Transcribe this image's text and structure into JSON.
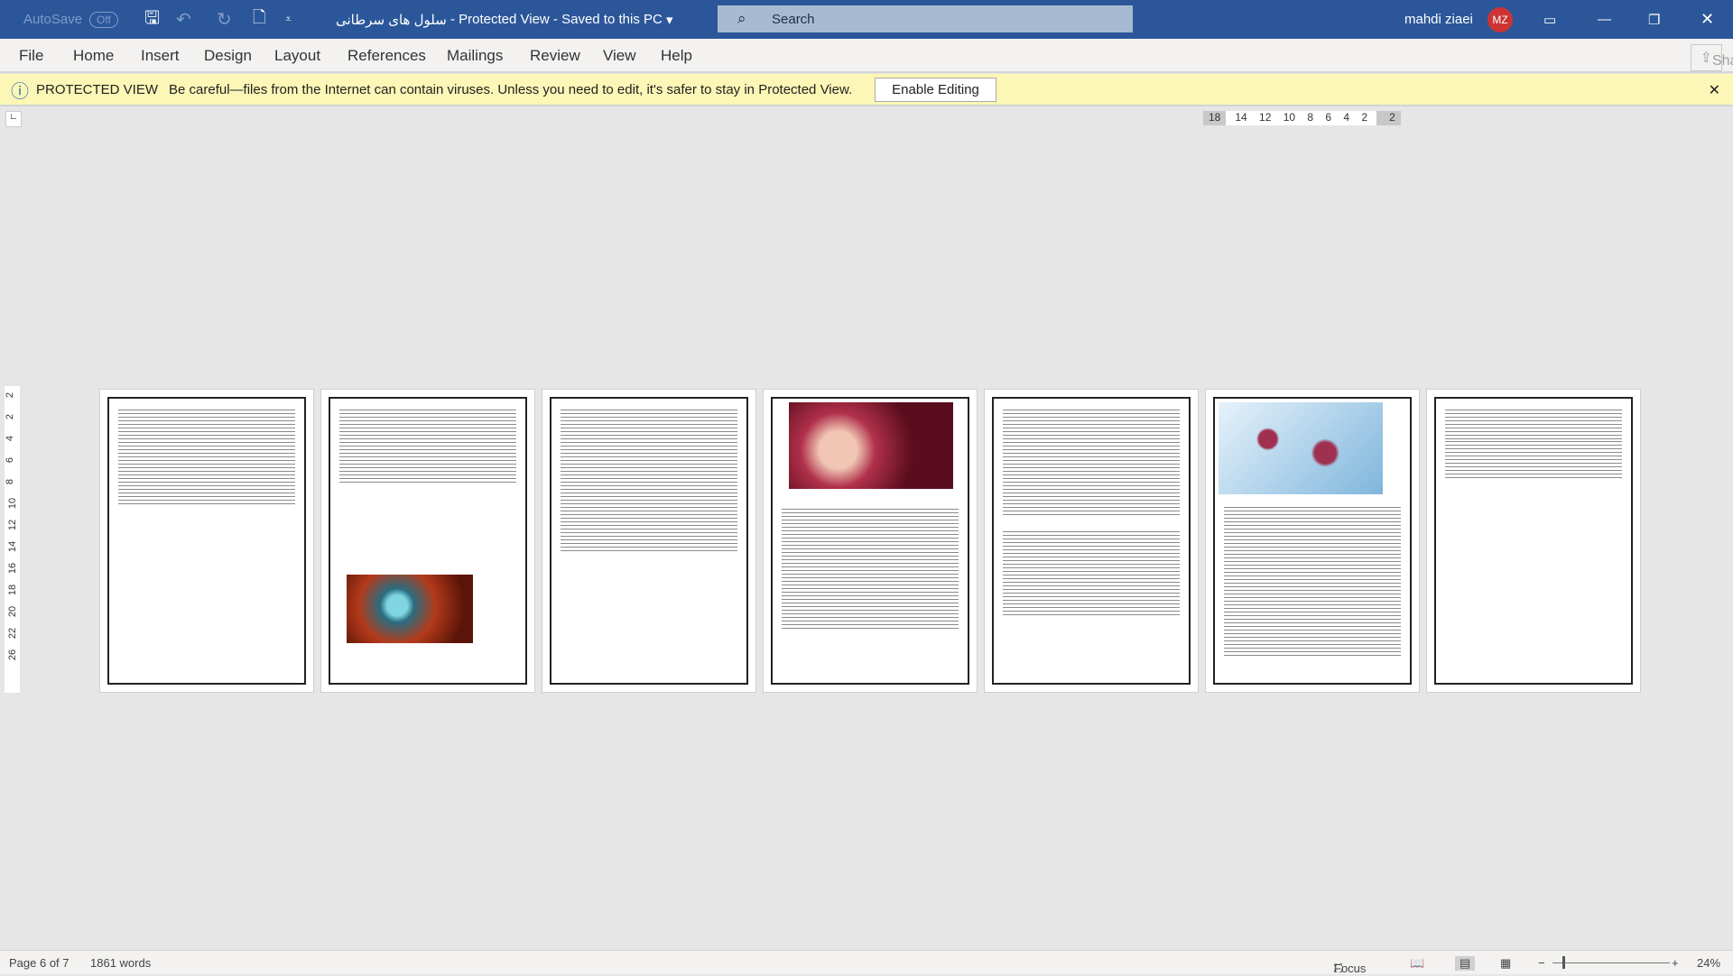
{
  "titlebar": {
    "autosave": "AutoSave",
    "autosave_state": "Off",
    "doc_title": "سلول های سرطانی",
    "mode": "Protected View",
    "save_state": "Saved to this PC",
    "search_placeholder": "Search",
    "user": "mahdi ziaei",
    "initials": "MZ"
  },
  "menu": {
    "items": [
      "File",
      "Home",
      "Insert",
      "Design",
      "Layout",
      "References",
      "Mailings",
      "Review",
      "View",
      "Help"
    ],
    "share": "Share"
  },
  "protected": {
    "label": "PROTECTED VIEW",
    "message": "Be careful—files from the Internet can contain viruses. Unless you need to edit, it's safer to stay in Protected View.",
    "button": "Enable Editing"
  },
  "ruler": {
    "left": "18",
    "ticks": "14 12 10 8 6 4 2",
    "right": "2"
  },
  "vruler": [
    "2",
    "2",
    "4",
    "6",
    "8",
    "10",
    "12",
    "14",
    "16",
    "18",
    "20",
    "22",
    "26"
  ],
  "status": {
    "page": "Page 6 of 7",
    "words": "1861 words",
    "focus": "Focus",
    "zoom": "24%"
  },
  "colors": {
    "titlebar": "#2b579a",
    "protected_bar": "#fcf7b6"
  }
}
